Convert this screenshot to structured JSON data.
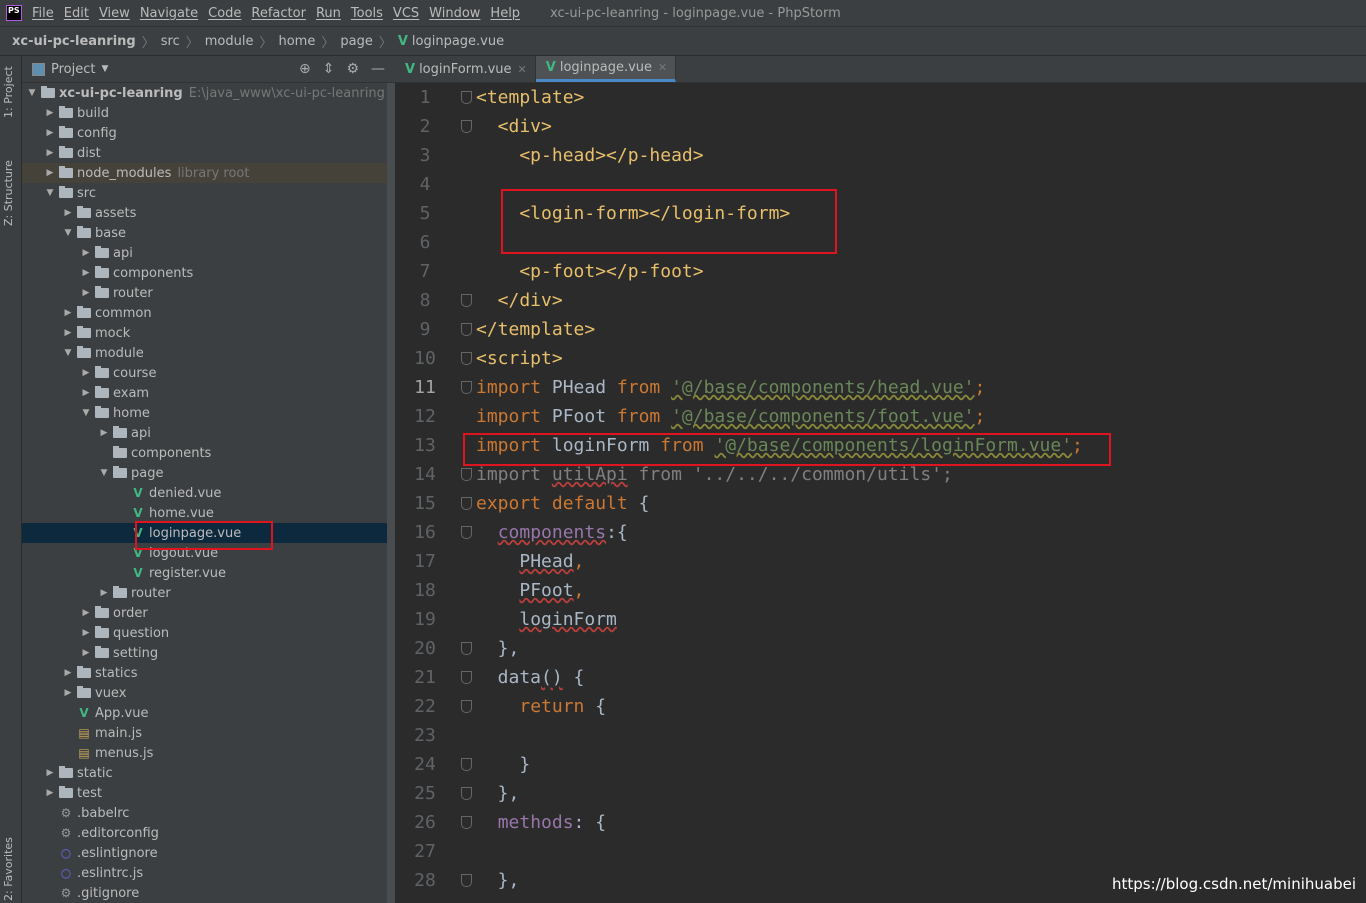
{
  "menubar": {
    "logo": "PS",
    "items": [
      "File",
      "Edit",
      "View",
      "Navigate",
      "Code",
      "Refactor",
      "Run",
      "Tools",
      "VCS",
      "Window",
      "Help"
    ],
    "title": "xc-ui-pc-leanring - loginpage.vue - PhpStorm"
  },
  "breadcrumb": [
    "xc-ui-pc-leanring",
    "src",
    "module",
    "home",
    "page",
    "loginpage.vue"
  ],
  "side_strip": {
    "project": "1: Project",
    "structure": "Z: Structure",
    "favorites": "2: Favorites"
  },
  "project_panel": {
    "title": "Project",
    "tree": [
      {
        "label": "xc-ui-pc-leanring",
        "level": 0,
        "type": "folder",
        "open": true,
        "hint": "E:\\java_www\\xc-ui-pc-leanring",
        "bold": true
      },
      {
        "label": "build",
        "level": 1,
        "type": "folder"
      },
      {
        "label": "config",
        "level": 1,
        "type": "folder"
      },
      {
        "label": "dist",
        "level": 1,
        "type": "folder"
      },
      {
        "label": "node_modules",
        "level": 1,
        "type": "folder",
        "hint": "library root",
        "lib": true
      },
      {
        "label": "src",
        "level": 1,
        "type": "folder",
        "open": true
      },
      {
        "label": "assets",
        "level": 2,
        "type": "folder"
      },
      {
        "label": "base",
        "level": 2,
        "type": "folder",
        "open": true
      },
      {
        "label": "api",
        "level": 3,
        "type": "folder"
      },
      {
        "label": "components",
        "level": 3,
        "type": "folder"
      },
      {
        "label": "router",
        "level": 3,
        "type": "folder"
      },
      {
        "label": "common",
        "level": 2,
        "type": "folder"
      },
      {
        "label": "mock",
        "level": 2,
        "type": "folder"
      },
      {
        "label": "module",
        "level": 2,
        "type": "folder",
        "open": true
      },
      {
        "label": "course",
        "level": 3,
        "type": "folder"
      },
      {
        "label": "exam",
        "level": 3,
        "type": "folder"
      },
      {
        "label": "home",
        "level": 3,
        "type": "folder",
        "open": true
      },
      {
        "label": "api",
        "level": 4,
        "type": "folder"
      },
      {
        "label": "components",
        "level": 4,
        "type": "folder",
        "leaf": true
      },
      {
        "label": "page",
        "level": 4,
        "type": "folder",
        "open": true
      },
      {
        "label": "denied.vue",
        "level": 5,
        "type": "vue"
      },
      {
        "label": "home.vue",
        "level": 5,
        "type": "vue"
      },
      {
        "label": "loginpage.vue",
        "level": 5,
        "type": "vue",
        "selected": true
      },
      {
        "label": "logout.vue",
        "level": 5,
        "type": "vue"
      },
      {
        "label": "register.vue",
        "level": 5,
        "type": "vue"
      },
      {
        "label": "router",
        "level": 4,
        "type": "folder"
      },
      {
        "label": "order",
        "level": 3,
        "type": "folder"
      },
      {
        "label": "question",
        "level": 3,
        "type": "folder"
      },
      {
        "label": "setting",
        "level": 3,
        "type": "folder"
      },
      {
        "label": "statics",
        "level": 2,
        "type": "folder"
      },
      {
        "label": "vuex",
        "level": 2,
        "type": "folder"
      },
      {
        "label": "App.vue",
        "level": 2,
        "type": "vue"
      },
      {
        "label": "main.js",
        "level": 2,
        "type": "js"
      },
      {
        "label": "menus.js",
        "level": 2,
        "type": "js"
      },
      {
        "label": "static",
        "level": 1,
        "type": "folder"
      },
      {
        "label": "test",
        "level": 1,
        "type": "folder"
      },
      {
        "label": ".babelrc",
        "level": 1,
        "type": "config"
      },
      {
        "label": ".editorconfig",
        "level": 1,
        "type": "gear"
      },
      {
        "label": ".eslintignore",
        "level": 1,
        "type": "ring"
      },
      {
        "label": ".eslintrc.js",
        "level": 1,
        "type": "ring"
      },
      {
        "label": ".gitignore",
        "level": 1,
        "type": "config"
      }
    ]
  },
  "tabs": [
    {
      "label": "loginForm.vue",
      "active": false
    },
    {
      "label": "loginpage.vue",
      "active": true
    }
  ],
  "code": {
    "current_line": 11,
    "lines": [
      [
        [
          "<template>",
          "tag"
        ]
      ],
      [
        [
          "  <div>",
          "tag"
        ]
      ],
      [
        [
          "    <p-head></p-head>",
          "tag"
        ]
      ],
      [],
      [
        [
          "    <login-form></login-form>",
          "tag"
        ]
      ],
      [],
      [
        [
          "    <p-foot></p-foot>",
          "tag"
        ]
      ],
      [
        [
          "  </div>",
          "tag"
        ]
      ],
      [
        [
          "</template>",
          "tag"
        ]
      ],
      [
        [
          "<script>",
          "tag"
        ]
      ],
      [
        [
          "import ",
          "kw"
        ],
        [
          "PHead ",
          "id"
        ],
        [
          "from ",
          "kw"
        ],
        [
          "'@/base/components/head.vue'",
          "str"
        ],
        [
          ";",
          "kw"
        ]
      ],
      [
        [
          "import ",
          "kw"
        ],
        [
          "PFoot ",
          "id"
        ],
        [
          "from ",
          "kw"
        ],
        [
          "'@/base/components/foot.vue'",
          "str"
        ],
        [
          ";",
          "kw"
        ]
      ],
      [
        [
          "import ",
          "kw"
        ],
        [
          "loginForm ",
          "id"
        ],
        [
          "from ",
          "kw"
        ],
        [
          "'@/base/components/loginForm.vue'",
          "str"
        ],
        [
          ";",
          "kw"
        ]
      ],
      [
        [
          "import ",
          "dim"
        ],
        [
          "utilApi",
          "dim err"
        ],
        [
          " from '../../../common/utils';",
          "dim"
        ]
      ],
      [
        [
          "export default ",
          "kw"
        ],
        [
          "{",
          "id"
        ]
      ],
      [
        [
          "  ",
          "id"
        ],
        [
          "components",
          "prop err"
        ],
        [
          ":{",
          "id"
        ]
      ],
      [
        [
          "    ",
          "id"
        ],
        [
          "PHead",
          "id err"
        ],
        [
          ",",
          "kw"
        ]
      ],
      [
        [
          "    ",
          "id"
        ],
        [
          "PFoot",
          "id err"
        ],
        [
          ",",
          "kw"
        ]
      ],
      [
        [
          "    ",
          "id"
        ],
        [
          "loginForm",
          "id err"
        ]
      ],
      [
        [
          "  },",
          "id"
        ]
      ],
      [
        [
          "  data",
          "id"
        ],
        [
          "()",
          "id err"
        ],
        [
          " {",
          "id"
        ]
      ],
      [
        [
          "    ",
          "id"
        ],
        [
          "return ",
          "kw"
        ],
        [
          "{",
          "id"
        ]
      ],
      [],
      [
        [
          "    }",
          "id"
        ]
      ],
      [
        [
          "  },",
          "id"
        ]
      ],
      [
        [
          "  ",
          "id"
        ],
        [
          "methods",
          "prop"
        ],
        [
          ": {",
          "id"
        ]
      ],
      [],
      [
        [
          "  },",
          "id"
        ]
      ]
    ],
    "fold_lines": [
      1,
      2,
      8,
      9,
      10,
      11,
      14,
      15,
      16,
      20,
      21,
      22,
      24,
      25,
      26,
      28
    ]
  },
  "watermark": "https://blog.csdn.net/minihuabei"
}
